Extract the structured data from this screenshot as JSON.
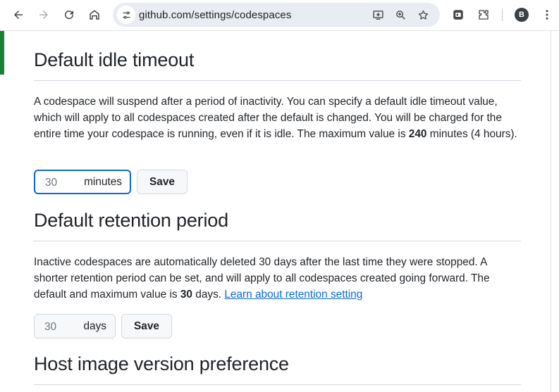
{
  "browser": {
    "url": "github.com/settings/codespaces",
    "profile_initial": "B",
    "icons": {
      "back": "back-arrow-icon",
      "forward": "forward-arrow-icon",
      "reload": "reload-icon",
      "home": "home-icon",
      "site_info": "site-info-icon",
      "install": "install-app-icon",
      "zoom": "zoom-icon",
      "bookmark": "star-icon",
      "extension_app": "extension-app-icon",
      "extensions": "puzzle-icon",
      "menu": "kebab-menu-icon"
    }
  },
  "idle_timeout": {
    "heading": "Default idle timeout",
    "text_before_bold": "A codespace will suspend after a period of inactivity. You can specify a default idle timeout value, which will apply to all codespaces created after the default is changed. You will be charged for the entire time your codespace is running, even if it is idle. The maximum value is ",
    "bold_value": "240",
    "text_after_bold": " minutes (4 hours).",
    "input_value": "30",
    "unit": "minutes",
    "save_label": "Save"
  },
  "retention": {
    "heading": "Default retention period",
    "text_before_bold": "Inactive codespaces are automatically deleted 30 days after the last time they were stopped. A shorter retention period can be set, and will apply to all codespaces created going forward. The default and maximum value is ",
    "bold_value": "30",
    "text_after_bold": " days. ",
    "link_text": "Learn about retention setting",
    "input_value": "30",
    "unit": "days",
    "save_label": "Save"
  },
  "host_image": {
    "heading": "Host image version preference"
  },
  "colors": {
    "link": "#0969da",
    "focus_border": "#0969da",
    "accent_green": "#1a7f37"
  }
}
